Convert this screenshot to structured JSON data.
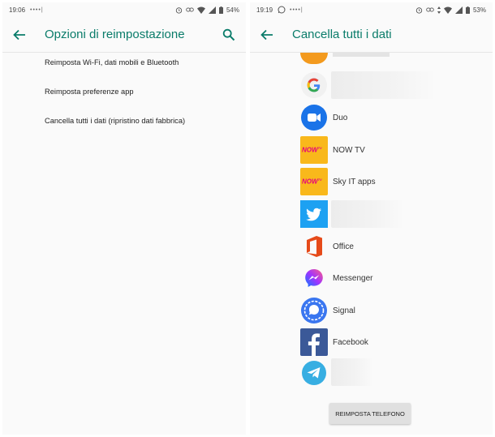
{
  "left_screen": {
    "status": {
      "time": "19:06",
      "notif_text": "••••|",
      "battery": "54%"
    },
    "title": "Opzioni di reimpostazione",
    "items": [
      {
        "label": "Reimposta Wi-Fi, dati mobili e Bluetooth"
      },
      {
        "label": "Reimposta preferenze app"
      },
      {
        "label": "Cancella tutti i dati (ripristino dati fabbrica)"
      }
    ]
  },
  "right_screen": {
    "status": {
      "time": "19:19",
      "notif_text": "••••|",
      "battery": "53%"
    },
    "title": "Cancella tutti i dati",
    "apps": [
      {
        "name": "",
        "icon": "google-icon"
      },
      {
        "name": "Duo",
        "icon": "duo-icon"
      },
      {
        "name": "NOW TV",
        "icon": "nowtv-icon"
      },
      {
        "name": "Sky IT apps",
        "icon": "skyit-icon"
      },
      {
        "name": "",
        "icon": "twitter-icon"
      },
      {
        "name": "Office",
        "icon": "office-icon"
      },
      {
        "name": "Messenger",
        "icon": "messenger-icon"
      },
      {
        "name": "Signal",
        "icon": "signal-icon"
      },
      {
        "name": "Facebook",
        "icon": "facebook-icon"
      },
      {
        "name": "",
        "icon": "telegram-icon"
      }
    ],
    "nowtv_logo_text": "NOW",
    "reset_button": "REIMPOSTA TELEFONO"
  },
  "colors": {
    "accent": "#0a7c6a",
    "background": "#fafafa"
  }
}
